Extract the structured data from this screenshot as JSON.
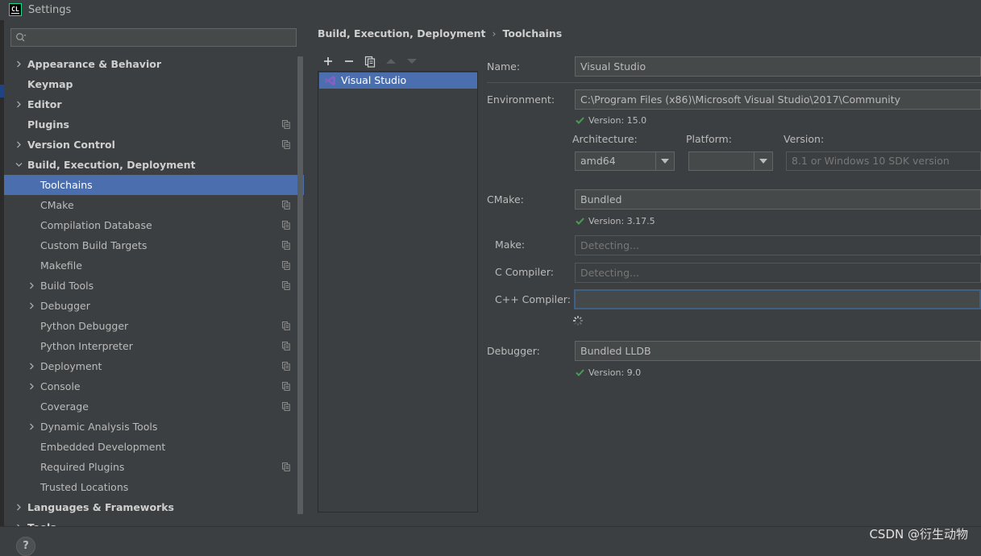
{
  "window": {
    "title": "Settings",
    "logo_text": "CL"
  },
  "search": {
    "placeholder": "",
    "value": ""
  },
  "sidebar": {
    "items": [
      {
        "label": "Appearance & Behavior",
        "level": 0,
        "expandable": true,
        "expanded": false,
        "copy": false
      },
      {
        "label": "Keymap",
        "level": 0,
        "expandable": false,
        "copy": false
      },
      {
        "label": "Editor",
        "level": 0,
        "expandable": true,
        "expanded": false,
        "copy": false
      },
      {
        "label": "Plugins",
        "level": 0,
        "expandable": false,
        "copy": true
      },
      {
        "label": "Version Control",
        "level": 0,
        "expandable": true,
        "expanded": false,
        "copy": true
      },
      {
        "label": "Build, Execution, Deployment",
        "level": 0,
        "expandable": true,
        "expanded": true,
        "copy": false
      },
      {
        "label": "Toolchains",
        "level": 1,
        "expandable": false,
        "copy": false,
        "selected": true
      },
      {
        "label": "CMake",
        "level": 1,
        "expandable": false,
        "copy": true
      },
      {
        "label": "Compilation Database",
        "level": 1,
        "expandable": false,
        "copy": true
      },
      {
        "label": "Custom Build Targets",
        "level": 1,
        "expandable": false,
        "copy": true
      },
      {
        "label": "Makefile",
        "level": 1,
        "expandable": false,
        "copy": true
      },
      {
        "label": "Build Tools",
        "level": 1,
        "expandable": true,
        "expanded": false,
        "copy": true
      },
      {
        "label": "Debugger",
        "level": 1,
        "expandable": true,
        "expanded": false,
        "copy": false
      },
      {
        "label": "Python Debugger",
        "level": 1,
        "expandable": false,
        "copy": true
      },
      {
        "label": "Python Interpreter",
        "level": 1,
        "expandable": false,
        "copy": true
      },
      {
        "label": "Deployment",
        "level": 1,
        "expandable": true,
        "expanded": false,
        "copy": true
      },
      {
        "label": "Console",
        "level": 1,
        "expandable": true,
        "expanded": false,
        "copy": true
      },
      {
        "label": "Coverage",
        "level": 1,
        "expandable": false,
        "copy": true
      },
      {
        "label": "Dynamic Analysis Tools",
        "level": 1,
        "expandable": true,
        "expanded": false,
        "copy": false
      },
      {
        "label": "Embedded Development",
        "level": 1,
        "expandable": false,
        "copy": false
      },
      {
        "label": "Required Plugins",
        "level": 1,
        "expandable": false,
        "copy": true
      },
      {
        "label": "Trusted Locations",
        "level": 1,
        "expandable": false,
        "copy": false
      },
      {
        "label": "Languages & Frameworks",
        "level": 0,
        "expandable": true,
        "expanded": false,
        "copy": false
      },
      {
        "label": "Tools",
        "level": 0,
        "expandable": true,
        "expanded": false,
        "copy": false
      }
    ]
  },
  "breadcrumb": {
    "parent": "Build, Execution, Deployment",
    "separator": "›",
    "current": "Toolchains"
  },
  "toolchains": {
    "toolbar": [
      "add",
      "remove",
      "copy",
      "move-up",
      "move-down"
    ],
    "items": [
      {
        "label": "Visual Studio",
        "selected": true
      }
    ]
  },
  "form": {
    "name_label": "Name:",
    "name_value": "Visual Studio",
    "environment_label": "Environment:",
    "environment_value": "C:\\Program Files (x86)\\Microsoft Visual Studio\\2017\\Community",
    "environment_status": "Version: 15.0",
    "architecture_label": "Architecture:",
    "architecture_value": "amd64",
    "platform_label": "Platform:",
    "platform_value": "",
    "version_label": "Version:",
    "version_placeholder": "8.1 or Windows 10 SDK version",
    "cmake_label": "CMake:",
    "cmake_value": "Bundled",
    "cmake_status": "Version: 3.17.5",
    "make_label": "Make:",
    "make_placeholder": "Detecting...",
    "c_compiler_label": "C Compiler:",
    "c_compiler_placeholder": "Detecting...",
    "cpp_compiler_label": "C++ Compiler:",
    "cpp_compiler_value": "",
    "debugger_label": "Debugger:",
    "debugger_value": "Bundled LLDB",
    "debugger_status": "Version: 9.0"
  },
  "footer": {
    "help_label": "?",
    "watermark": "CSDN @衍生动物"
  },
  "colors": {
    "selection": "#4b6eaf",
    "background": "#3c3f41",
    "success": "#499c54",
    "visual_studio": "#865fc5"
  }
}
